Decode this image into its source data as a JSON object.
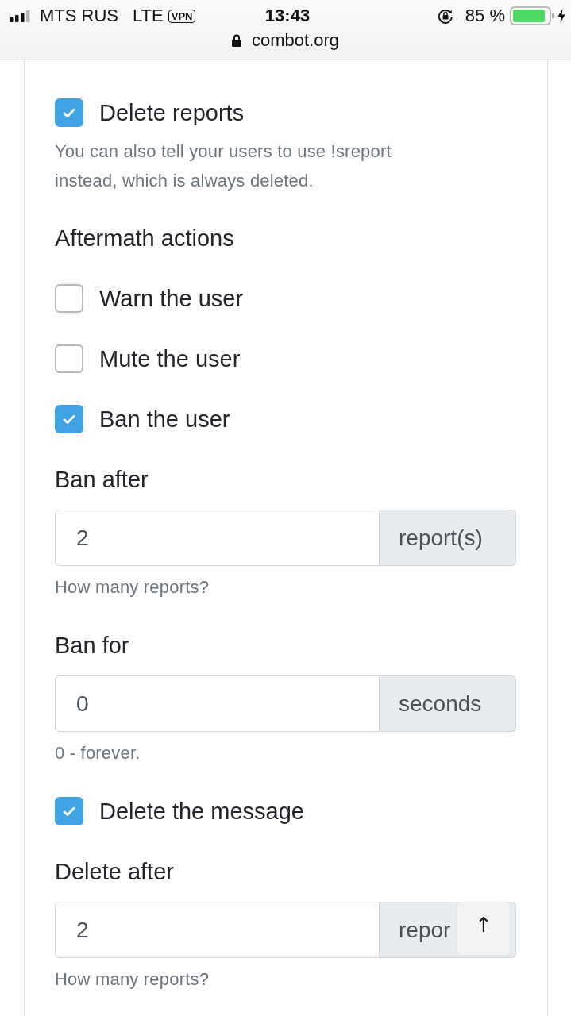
{
  "status_bar": {
    "carrier": "MTS RUS",
    "network": "LTE",
    "vpn_badge": "VPN",
    "time": "13:43",
    "battery_percent": "85 %",
    "url": "combot.org"
  },
  "settings": [
    {
      "kind": "checkbox",
      "label": "Delete reports",
      "checked": true
    },
    {
      "kind": "help",
      "text": "You can also tell your users to use !sreport instead, which is always deleted."
    },
    {
      "kind": "heading",
      "text": "Aftermath actions"
    },
    {
      "kind": "checkbox",
      "label": "Warn the user",
      "checked": false
    },
    {
      "kind": "checkbox",
      "label": "Mute the user",
      "checked": false
    },
    {
      "kind": "checkbox",
      "label": "Ban the user",
      "checked": true
    },
    {
      "kind": "field",
      "label": "Ban after",
      "value": "2",
      "unit": "report(s)",
      "help": "How many reports?"
    },
    {
      "kind": "field",
      "label": "Ban for",
      "value": "0",
      "unit": "seconds",
      "help": "0 - forever."
    },
    {
      "kind": "checkbox",
      "label": "Delete the message",
      "checked": true
    },
    {
      "kind": "field",
      "label": "Delete after",
      "value": "2",
      "unit": "repor",
      "help": "How many reports?"
    }
  ],
  "back_to_top": {
    "label": "↑"
  }
}
